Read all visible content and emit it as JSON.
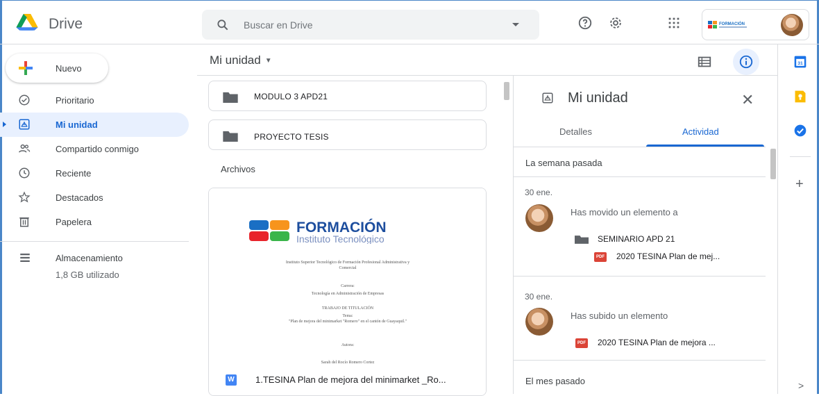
{
  "app": {
    "title": "Drive"
  },
  "search": {
    "placeholder": "Buscar en Drive"
  },
  "header": {
    "icons": [
      "help-icon",
      "settings-icon",
      "apps-grid-icon"
    ],
    "account_brand": "FORMACIÓN"
  },
  "sidebar": {
    "new_label": "Nuevo",
    "items": [
      {
        "label": "Prioritario",
        "icon": "check-circle-icon"
      },
      {
        "label": "Mi unidad",
        "icon": "my-drive-icon",
        "active": true
      },
      {
        "label": "Compartido conmigo",
        "icon": "shared-people-icon"
      },
      {
        "label": "Reciente",
        "icon": "clock-icon"
      },
      {
        "label": "Destacados",
        "icon": "star-icon"
      },
      {
        "label": "Papelera",
        "icon": "trash-icon"
      }
    ],
    "storage": {
      "label": "Almacenamiento",
      "used": "1,8 GB utilizado"
    }
  },
  "main": {
    "title": "Mi unidad",
    "folders": [
      {
        "name": "MODULO 3 APD21"
      },
      {
        "name": "PROYECTO TESIS"
      }
    ],
    "files_label": "Archivos",
    "file": {
      "name": "1.TESINA Plan de mejora del minimarket _Ro...",
      "preview": {
        "brand_title": "FORMACIÓN",
        "brand_subtitle": "Instituto Tecnológico",
        "lines": [
          "Instituto Superior Tecnológico de Formación Profesional Administrativa y",
          "Comercial",
          "Carrera:",
          "Tecnología en Administración de Empresas",
          "TRABAJO DE TITULACIÓN",
          "Tema:",
          "\"Plan de mejora del minimarket \"Romero\" en el cantón de Guayaquil.\"",
          "Autora:",
          "Sarah del Rocío Romero Cortez"
        ]
      }
    }
  },
  "panel": {
    "title": "Mi unidad",
    "tabs": [
      {
        "label": "Detalles"
      },
      {
        "label": "Actividad",
        "active": true
      }
    ],
    "periods": {
      "last_week": "La semana pasada",
      "last_month": "El mes pasado"
    },
    "activities": [
      {
        "date": "30 ene.",
        "text": "Has movido un elemento a",
        "folder": "SEMINARIO APD 21",
        "file": "2020 TESINA Plan de mej..."
      },
      {
        "date": "30 ene.",
        "text": "Has subido un elemento",
        "file": "2020 TESINA Plan de mejora ..."
      }
    ],
    "pdf_badge": "PDF"
  },
  "rail": {
    "icons": [
      "calendar-icon",
      "keep-icon",
      "tasks-icon"
    ],
    "calendar_day": "31"
  },
  "colors": {
    "accent": "#1967d2",
    "active_bg": "#e8f0fe",
    "border": "#dadce0"
  }
}
